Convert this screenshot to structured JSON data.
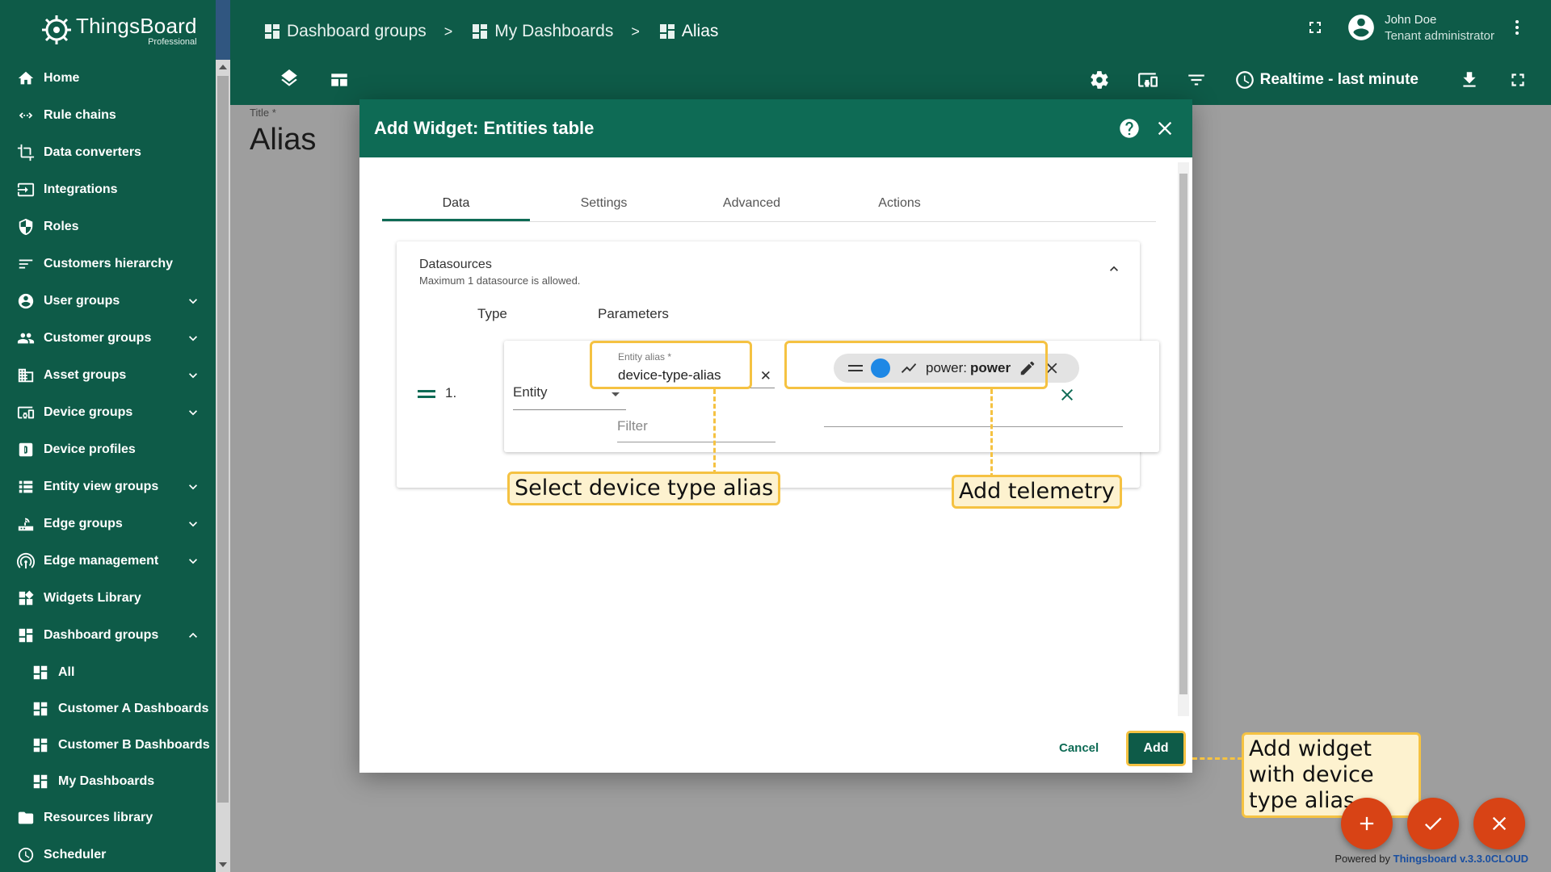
{
  "app": {
    "name": "ThingsBoard",
    "edition": "Professional"
  },
  "breadcrumbs": [
    "Dashboard groups",
    "My Dashboards",
    "Alias"
  ],
  "user": {
    "name": "John Doe",
    "role": "Tenant administrator"
  },
  "toolbar": {
    "timewindow": "Realtime - last minute"
  },
  "sidebar": {
    "items": [
      {
        "label": "Home",
        "icon": "home-icon"
      },
      {
        "label": "Rule chains",
        "icon": "rule-chains-icon"
      },
      {
        "label": "Data converters",
        "icon": "data-converters-icon"
      },
      {
        "label": "Integrations",
        "icon": "integrations-icon"
      },
      {
        "label": "Roles",
        "icon": "shield-icon"
      },
      {
        "label": "Customers hierarchy",
        "icon": "hierarchy-icon"
      },
      {
        "label": "User groups",
        "icon": "user-icon"
      },
      {
        "label": "Customer groups",
        "icon": "people-icon"
      },
      {
        "label": "Asset groups",
        "icon": "asset-icon"
      },
      {
        "label": "Device groups",
        "icon": "device-icon"
      },
      {
        "label": "Device profiles",
        "icon": "device-profile-icon"
      },
      {
        "label": "Entity view groups",
        "icon": "entity-view-icon"
      },
      {
        "label": "Edge groups",
        "icon": "edge-icon"
      },
      {
        "label": "Edge management",
        "icon": "edge-management-icon"
      },
      {
        "label": "Widgets Library",
        "icon": "widgets-icon"
      },
      {
        "label": "Dashboard groups",
        "icon": "dashboard-icon"
      },
      {
        "label": "All",
        "icon": "dashboard-icon"
      },
      {
        "label": "Customer A Dashboards",
        "icon": "dashboard-icon"
      },
      {
        "label": "Customer B Dashboards",
        "icon": "dashboard-icon"
      },
      {
        "label": "My Dashboards",
        "icon": "dashboard-icon"
      },
      {
        "label": "Resources library",
        "icon": "folder-icon"
      },
      {
        "label": "Scheduler",
        "icon": "clock-icon"
      }
    ]
  },
  "dashboard": {
    "title_label": "Title *",
    "title": "Alias"
  },
  "dialog": {
    "title": "Add Widget: Entities table",
    "tabs": [
      "Data",
      "Settings",
      "Advanced",
      "Actions"
    ],
    "datasources": {
      "title": "Datasources",
      "subtitle": "Maximum 1 datasource is allowed.",
      "col_type": "Type",
      "col_params": "Parameters",
      "row": {
        "index": "1.",
        "type": "Entity",
        "alias_label": "Entity alias *",
        "alias_value": "device-type-alias",
        "filter_placeholder": "Filter",
        "key_name": "power:",
        "key_label": "power",
        "key_color": "#1e88e5"
      }
    },
    "cancel": "Cancel",
    "add": "Add"
  },
  "annotations": {
    "alias": "Select device type alias",
    "telemetry": "Add telemetry",
    "add": "Add widget with device type alias"
  },
  "footer": {
    "prefix": "Powered by",
    "brand": "Thingsboard v.3.3.0CLOUD"
  }
}
